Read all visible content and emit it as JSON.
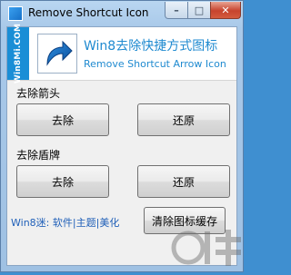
{
  "window": {
    "title": "Remove Shortcut Icon",
    "controls": {
      "minimize": "–",
      "maximize": "□",
      "close": "✕"
    }
  },
  "banner": {
    "side_text": "Win8Mi.COM",
    "title": "Win8去除快捷方式图标",
    "subtitle": "Remove Shortcut Arrow Icon"
  },
  "arrow_group": {
    "label": "去除箭头",
    "remove_label": "去除",
    "restore_label": "还原"
  },
  "shield_group": {
    "label": "去除盾牌",
    "remove_label": "去除",
    "restore_label": "还原"
  },
  "footer": {
    "links": [
      "Win8迷",
      "软件",
      "主题",
      "美化"
    ],
    "clear_cache_label": "清除图标缓存"
  },
  "colors": {
    "accent": "#1f8ad0",
    "side_strip": "#1a8ed6",
    "link": "#1f5fb8"
  },
  "icons": [
    "app-icon",
    "shortcut-arrow-icon",
    "watermark-logo"
  ]
}
